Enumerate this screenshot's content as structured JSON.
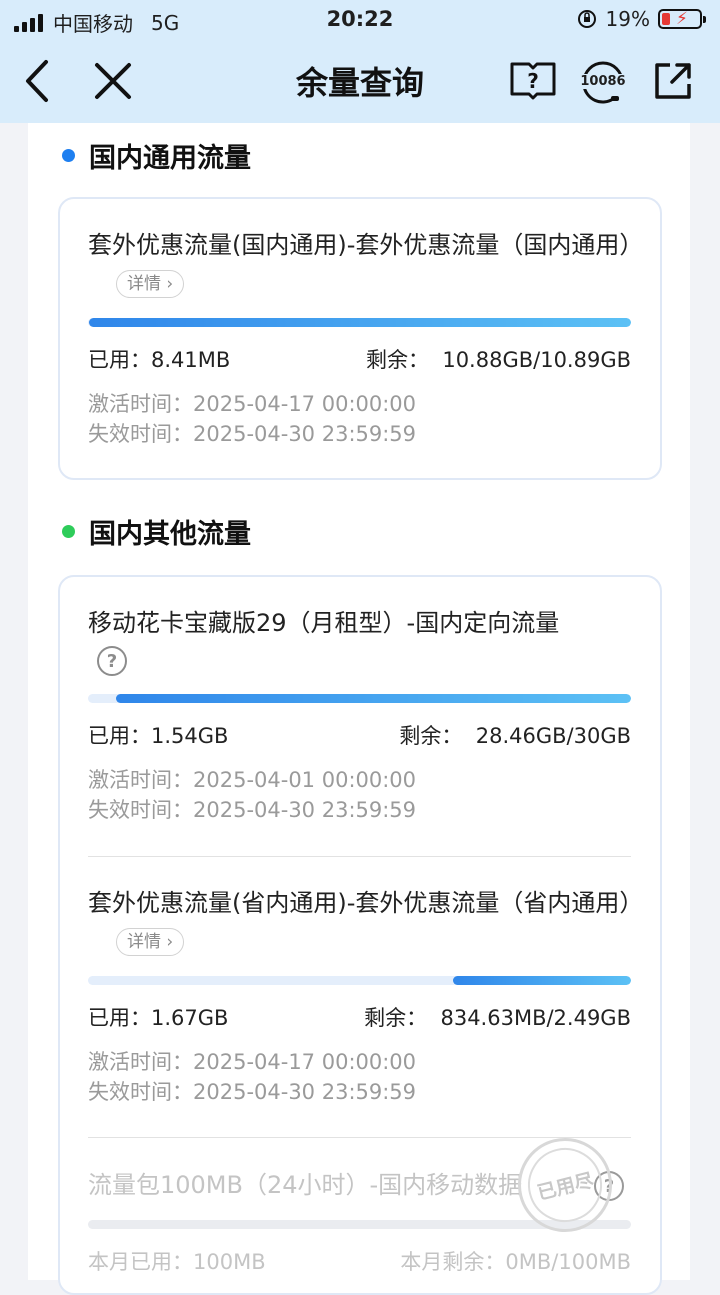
{
  "status_bar": {
    "carrier": "中国移动",
    "network": "5G",
    "time": "20:22",
    "battery": "19%"
  },
  "nav": {
    "title": "余量查询",
    "hotline": "10086",
    "icons": [
      "back-icon",
      "close-icon",
      "help-book-icon",
      "hotline-icon",
      "share-icon"
    ]
  },
  "sections": [
    {
      "heading": "国内通用流量",
      "dot_color": "#1e7ff0",
      "items": [
        {
          "title": "套外优惠流量(国内通用)-套外优惠流量（国内通用）",
          "detail_label": "详情",
          "progress_remaining": 0.999,
          "used_label": "已用：",
          "used": "8.41MB",
          "remain_label": "剩余：",
          "remain": "10.88GB/10.89GB",
          "activate_label": "激活时间：",
          "activate": "2025-04-17 00:00:00",
          "expire_label": "失效时间：",
          "expire": "2025-04-30 23:59:59"
        }
      ]
    },
    {
      "heading": "国内其他流量",
      "dot_color": "#2ecc5a",
      "items": [
        {
          "title": "移动花卡宝藏版29（月租型）-国内定向流量",
          "help": "?",
          "progress_remaining": 0.949,
          "used_label": "已用：",
          "used": "1.54GB",
          "remain_label": "剩余：",
          "remain": "28.46GB/30GB",
          "activate_label": "激活时间：",
          "activate": "2025-04-01 00:00:00",
          "expire_label": "失效时间：",
          "expire": "2025-04-30 23:59:59"
        },
        {
          "title": "套外优惠流量(省内通用)-套外优惠流量（省内通用）",
          "detail_label": "详情",
          "progress_remaining": 0.327,
          "used_label": "已用：",
          "used": "1.67GB",
          "remain_label": "剩余：",
          "remain": "834.63MB/2.49GB",
          "activate_label": "激活时间：",
          "activate": "2025-04-17 00:00:00",
          "expire_label": "失效时间：",
          "expire": "2025-04-30 23:59:59"
        },
        {
          "title": "流量包100MB（24小时）-国内移动数据",
          "help": "?",
          "progress_remaining": 0,
          "used_label": "本月已用：",
          "used": "100MB",
          "remain_label": "本月剩余：",
          "remain": "0MB/100MB",
          "stamp": "已用尽"
        }
      ]
    }
  ]
}
